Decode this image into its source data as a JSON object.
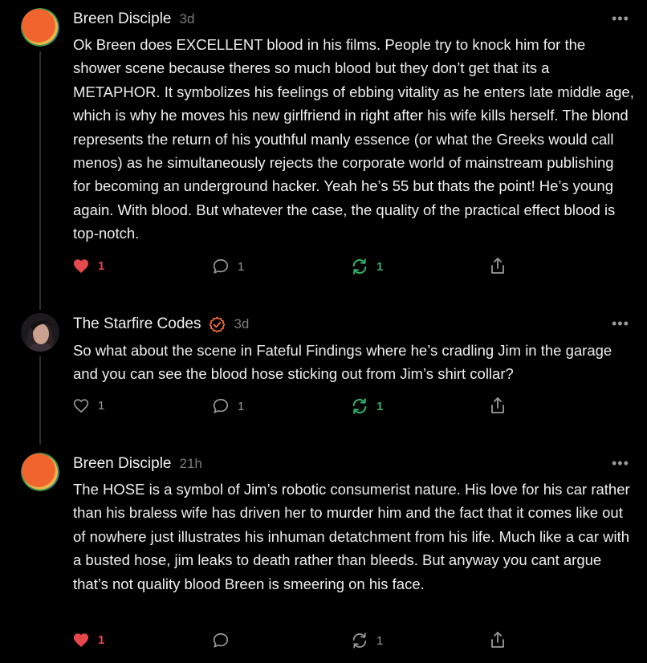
{
  "comments": [
    {
      "author": "Breen Disciple",
      "time": "3d",
      "more_label": "•••",
      "body": "Ok Breen does EXCELLENT blood in his films. People try to knock him for the shower scene because theres so much blood but they don’t get that its a METAPHOR. It symbolizes his feelings of ebbing vitality as he enters late middle age, which is why he moves his new girlfriend in right after his wife kills herself. The blond represents the return of his youthful manly essence (or what the Greeks would call menos) as he simultaneously rejects the corporate world of mainstream publishing for becoming an underground hacker. Yeah he’s 55 but thats the point! He’s young again. With blood. But whatever the case, the quality of the practical effect blood is top-notch.",
      "likes": "1",
      "replies": "1",
      "restacks": "1",
      "liked": true,
      "restacked": true
    },
    {
      "author": "The Starfire Codes",
      "time": "3d",
      "more_label": "•••",
      "verified_icon": "check-circle-icon",
      "body": "So what about the scene in Fateful Findings where he’s cradling Jim in the garage and you can see the blood hose sticking out from Jim’s shirt collar?",
      "likes": "1",
      "replies": "1",
      "restacks": "1",
      "liked": false,
      "restacked": true
    },
    {
      "author": "Breen Disciple",
      "time": "21h",
      "more_label": "•••",
      "body": "The HOSE is a symbol of Jim’s robotic consumerist nature. His love for his car rather than his braless wife has driven her to murder him and the fact that it comes like out of nowhere just illustrates his inhuman detatchment from his life. Much like a car with a busted hose, jim leaks to death rather than bleeds. But anyway you cant argue that’s not quality blood Breen is smeering on his face.",
      "likes": "1",
      "replies": "",
      "restacks": "1",
      "liked": true,
      "restacked": false
    }
  ],
  "colors": {
    "like_red": "#e5484d",
    "restack_green": "#2fb36b",
    "muted": "#9a9a9a",
    "verified_orange": "#f26c3a"
  }
}
